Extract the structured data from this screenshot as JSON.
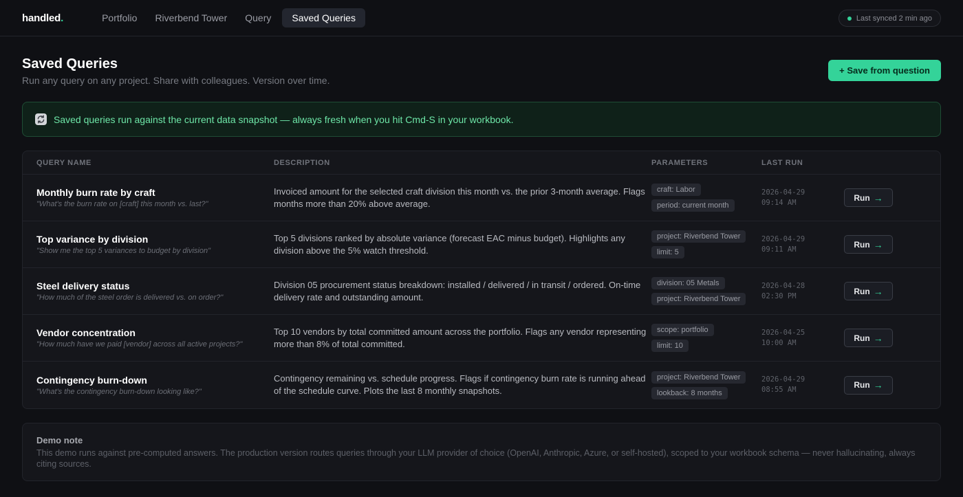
{
  "app": {
    "logo_text": "handled",
    "logo_dot": "."
  },
  "nav": {
    "items": [
      {
        "label": "Portfolio",
        "active": false
      },
      {
        "label": "Riverbend Tower",
        "active": false
      },
      {
        "label": "Query",
        "active": false
      },
      {
        "label": "Saved Queries",
        "active": true
      }
    ]
  },
  "sync": {
    "label": "Last synced 2 min ago",
    "status_color": "#34d399"
  },
  "header": {
    "title": "Saved Queries",
    "subtitle": "Run any query on any project. Share with colleagues. Version over time.",
    "save_button": "+ Save from question"
  },
  "banner": {
    "icon": "refresh-icon",
    "text": "Saved queries run against the current data snapshot — always fresh when you hit Cmd-S in your workbook."
  },
  "table": {
    "columns": {
      "name": "QUERY NAME",
      "description": "DESCRIPTION",
      "parameters": "PARAMETERS",
      "last_run": "LAST RUN"
    },
    "run_label": "Run",
    "run_icon": "arrow-right-icon",
    "rows": [
      {
        "name": "Monthly burn rate by craft",
        "prompt": "\"What's the burn rate on [craft] this month vs. last?\"",
        "description": "Invoiced amount for the selected craft division this month vs. the prior 3-month average. Flags months more than 20% above average.",
        "params": [
          "craft: Labor",
          "period: current month"
        ],
        "last_run_date": "2026-04-29",
        "last_run_time": "09:14 AM"
      },
      {
        "name": "Top variance by division",
        "prompt": "\"Show me the top 5 variances to budget by division\"",
        "description": "Top 5 divisions ranked by absolute variance (forecast EAC minus budget). Highlights any division above the 5% watch threshold.",
        "params": [
          "project: Riverbend Tower",
          "limit: 5"
        ],
        "last_run_date": "2026-04-29",
        "last_run_time": "09:11 AM"
      },
      {
        "name": "Steel delivery status",
        "prompt": "\"How much of the steel order is delivered vs. on order?\"",
        "description": "Division 05 procurement status breakdown: installed / delivered / in transit / ordered. On-time delivery rate and outstanding amount.",
        "params": [
          "division: 05 Metals",
          "project: Riverbend Tower"
        ],
        "last_run_date": "2026-04-28",
        "last_run_time": "02:30 PM"
      },
      {
        "name": "Vendor concentration",
        "prompt": "\"How much have we paid [vendor] across all active projects?\"",
        "description": "Top 10 vendors by total committed amount across the portfolio. Flags any vendor representing more than 8% of total committed.",
        "params": [
          "scope: portfolio",
          "limit: 10"
        ],
        "last_run_date": "2026-04-25",
        "last_run_time": "10:00 AM"
      },
      {
        "name": "Contingency burn-down",
        "prompt": "\"What's the contingency burn-down looking like?\"",
        "description": "Contingency remaining vs. schedule progress. Flags if contingency burn rate is running ahead of the schedule curve. Plots the last 8 monthly snapshots.",
        "params": [
          "project: Riverbend Tower",
          "lookback: 8 months"
        ],
        "last_run_date": "2026-04-29",
        "last_run_time": "08:55 AM"
      }
    ]
  },
  "note": {
    "title": "Demo note",
    "body": "This demo runs against pre-computed answers. The production version routes queries through your LLM provider of choice (OpenAI, Anthropic, Azure, or self-hosted), scoped to your workbook schema — never hallucinating, always citing sources."
  },
  "colors": {
    "accent": "#34d399",
    "background": "#0f1014",
    "banner_text": "#6ee7a8"
  }
}
